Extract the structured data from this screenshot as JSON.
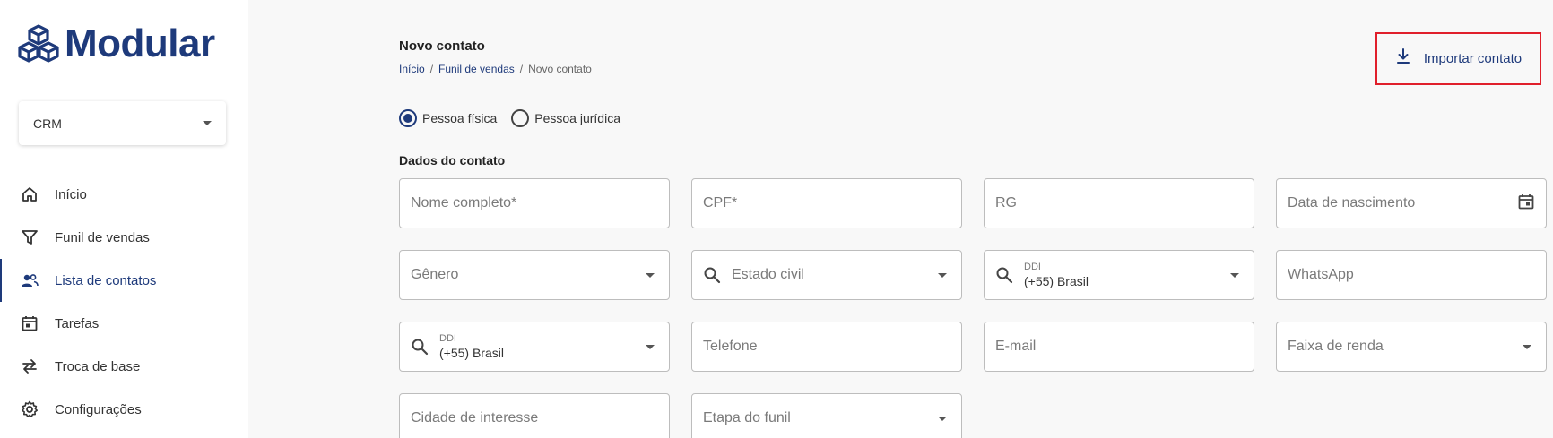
{
  "brand": {
    "name": "Modular",
    "color": "#1e3a7b"
  },
  "module_select": {
    "value": "CRM"
  },
  "nav": [
    {
      "label": "Início",
      "icon": "home-icon"
    },
    {
      "label": "Funil de vendas",
      "icon": "funnel-icon"
    },
    {
      "label": "Lista de contatos",
      "icon": "contacts-icon",
      "active": true
    },
    {
      "label": "Tarefas",
      "icon": "calendar-icon"
    },
    {
      "label": "Troca de base",
      "icon": "swap-icon"
    },
    {
      "label": "Configurações",
      "icon": "gear-icon"
    }
  ],
  "header": {
    "title": "Novo contato",
    "breadcrumb": [
      "Início",
      "Funil de vendas",
      "Novo contato"
    ],
    "breadcrumb_sep": "/",
    "import_label": "Importar contato"
  },
  "person_type": {
    "options": [
      "Pessoa física",
      "Pessoa jurídica"
    ],
    "selected": "Pessoa física"
  },
  "form": {
    "section_title": "Dados do contato",
    "nome": "Nome completo*",
    "cpf": "CPF*",
    "rg": "RG",
    "nascimento": "Data de nascimento",
    "genero": "Gênero",
    "estado_civil": "Estado civil",
    "ddi_label": "DDI",
    "ddi_value": "(+55) Brasil",
    "whatsapp": "WhatsApp",
    "telefone": "Telefone",
    "email": "E-mail",
    "faixa_renda": "Faixa de renda",
    "cidade": "Cidade de interesse",
    "etapa": "Etapa do funil"
  },
  "colors": {
    "accent": "#1e3a7b",
    "highlight": "#e01f2b"
  }
}
